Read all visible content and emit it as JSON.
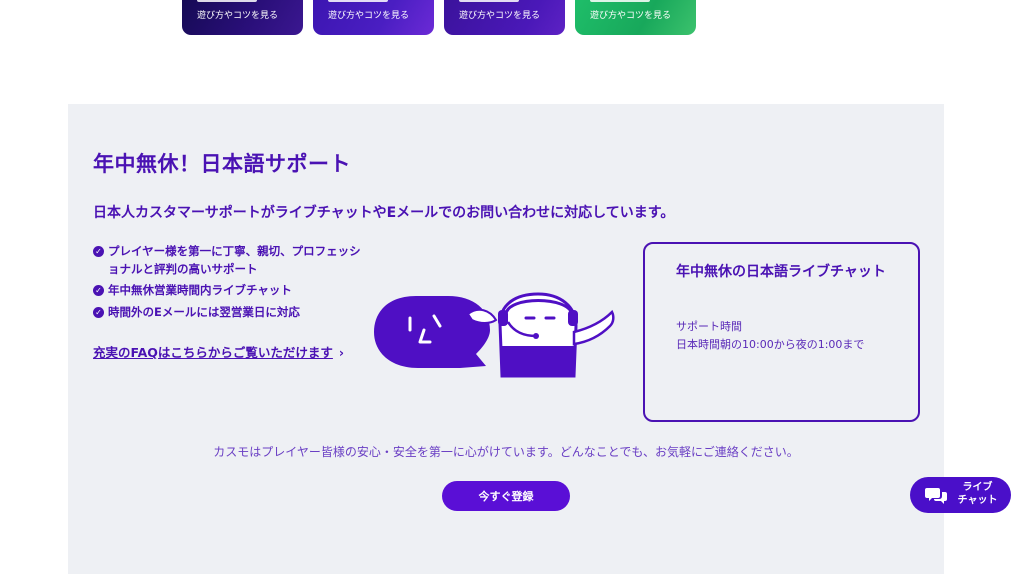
{
  "game_cards": [
    {
      "link_label": "遊び方やコツを見る",
      "color": "#1a0c5e"
    },
    {
      "link_label": "遊び方やコツを見る",
      "color": "#4a1ec2"
    },
    {
      "link_label": "遊び方やコツを見る",
      "color": "#4a18b8"
    },
    {
      "link_label": "遊び方やコツを見る",
      "color": "#1fb864"
    }
  ],
  "support": {
    "title": "年中無休！日本語サポート",
    "subtitle": "日本人カスタマーサポートがライブチャットやEメールでのお問い合わせに対応しています。",
    "features": [
      "プレイヤー様を第一に丁寧、親切、プロフェッショナルと評判の高いサポート",
      "年中無休営業時間内ライブチャット",
      "時間外のEメールには翌営業日に対応"
    ],
    "faq_link": "充実のFAQはこちらからご覧いただけます",
    "chat_box": {
      "title": "年中無休の日本語ライブチャット",
      "hours_label": "サポート時間",
      "hours_value": "日本時間朝の10:00から夜の1:00まで"
    },
    "note": "カスモはプレイヤー皆様の安心・安全を第一に心がけています。どんなことでも、お気軽にご連絡ください。",
    "register_button": "今すぐ登録"
  },
  "live_chat_button": {
    "line1": "ライブ",
    "line2": "チャット"
  },
  "colors": {
    "accent": "#4a12b3",
    "button": "#5a0fd6",
    "panel_bg": "#eef0f4"
  },
  "icons": [
    "check-icon",
    "chevron-right-icon",
    "chat-bubbles-icon",
    "mascot-illustration"
  ]
}
